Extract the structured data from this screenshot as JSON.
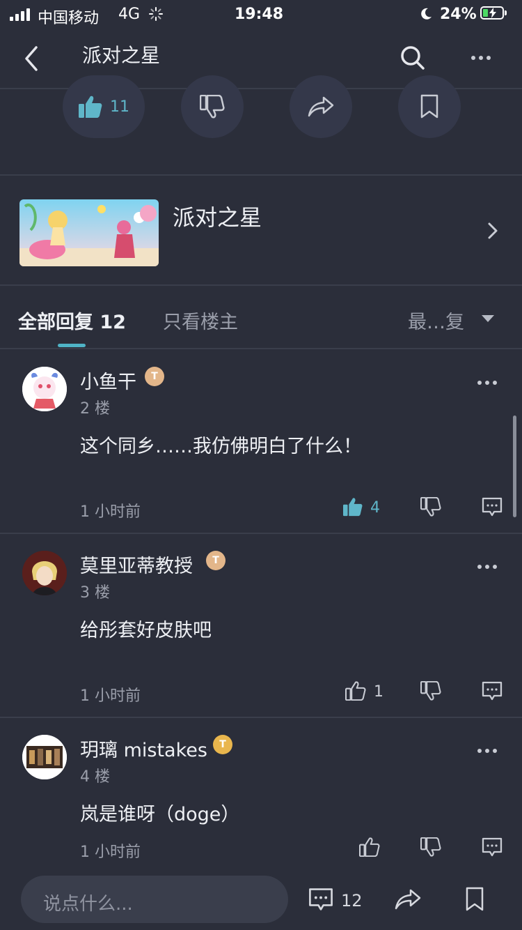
{
  "status_bar": {
    "carrier": "中国移动",
    "network": "4G",
    "time": "19:48",
    "battery_pct": "24%"
  },
  "nav": {
    "title": "派对之星"
  },
  "post_actions": {
    "like_count": "11"
  },
  "game_card": {
    "name": "派对之星"
  },
  "tabs": {
    "all_replies": "全部回复 12",
    "owner_only": "只看楼主",
    "sort": "最…复"
  },
  "replies": [
    {
      "user": "小鱼干",
      "badge": "T",
      "floor": "2 楼",
      "content": "这个同乡……我仿佛明白了什么！",
      "time": "1 小时前",
      "likes": "4",
      "liked": true
    },
    {
      "user": "莫里亚蒂教授",
      "badge": "T",
      "floor": "3 楼",
      "content": "给彤套好皮肤吧",
      "time": "1 小时前",
      "likes": "1",
      "liked": false
    },
    {
      "user": "玥璃 mistakes",
      "badge": "T",
      "floor": "4 楼",
      "content": "岚是谁呀（doge）",
      "time": "1 小时前",
      "likes": "",
      "liked": false
    }
  ],
  "bottom_bar": {
    "input_placeholder": "说点什么...",
    "comment_count": "12"
  },
  "colors": {
    "background": "#2b2e3a",
    "accent": "#4fb3c6",
    "badge": "#e9b64d"
  }
}
